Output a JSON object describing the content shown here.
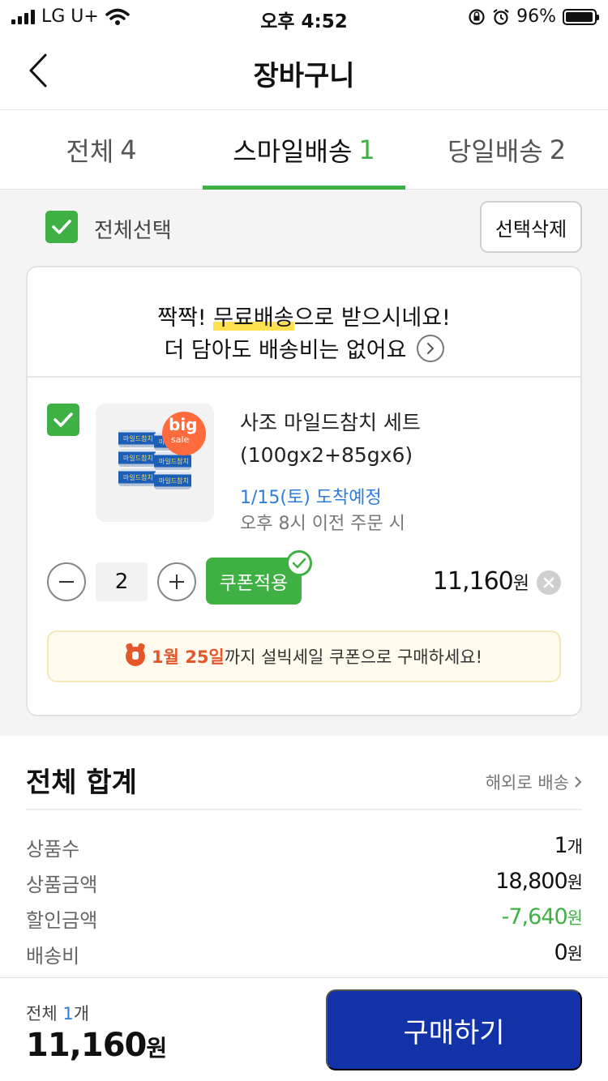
{
  "statusbar": {
    "carrier": "LG U+",
    "time": "오후 4:52",
    "battery": "96%",
    "battery_level": 0.96
  },
  "nav": {
    "title": "장바구니"
  },
  "tabs": [
    {
      "label": "전체",
      "count": "4"
    },
    {
      "label": "스마일배송",
      "count": "1"
    },
    {
      "label": "당일배송",
      "count": "2"
    }
  ],
  "active_tab": 1,
  "select_bar": {
    "select_all_label": "전체선택",
    "delete_label": "선택삭제"
  },
  "banner": {
    "line1_prefix": "짝짝! ",
    "line1_highlight": "무료배송",
    "line1_suffix": "으로 받으시네요!",
    "line2": "더 담아도 배송비는 없어요"
  },
  "item": {
    "name": "사조 마일드참치 세트(100gx2+85gx6)",
    "arrival": "1/15(토) 도착예정",
    "order_note": "오후 8시 이전 주문 시",
    "quantity": "2",
    "coupon_label": "쿠폰적용",
    "price": "11,160",
    "price_unit": "원",
    "thumb_badge_top": "big",
    "thumb_badge_bottom": "sale",
    "can_label": "마일드참치"
  },
  "promo": {
    "date": "1월 25일",
    "text": "까지 설빅세일 쿠폰으로 구매하세요!"
  },
  "summary": {
    "title": "전체 합계",
    "overseas_link": "해외로 배송",
    "rows": [
      {
        "label": "상품수",
        "value": "1",
        "unit": "개"
      },
      {
        "label": "상품금액",
        "value": "18,800",
        "unit": "원"
      },
      {
        "label": "할인금액",
        "value": "-7,640",
        "unit": "원"
      },
      {
        "label": "배송비",
        "value": "0",
        "unit": "원"
      }
    ]
  },
  "bottom": {
    "count_prefix": "전체 ",
    "count": "1",
    "count_unit": "개",
    "total": "11,160",
    "total_unit": "원",
    "buy_label": "구매하기"
  },
  "colors": {
    "accent_green": "#3fb043",
    "buy_blue": "#1232a8",
    "link_blue": "#2e7ddc",
    "promo_orange": "#e5562b"
  }
}
